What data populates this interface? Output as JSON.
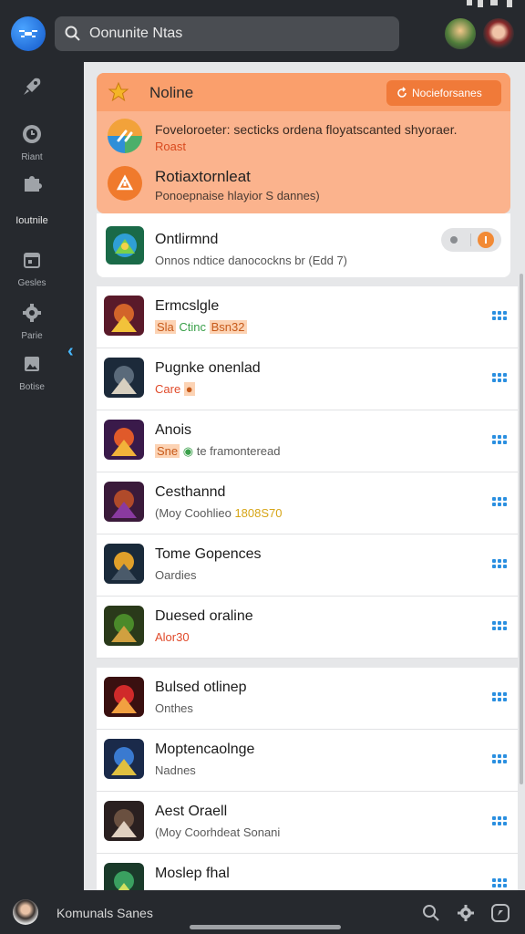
{
  "header": {
    "search_text": "Oonunite Ntas",
    "search_icon": "search-icon",
    "logo_icon": "drone-logo-icon"
  },
  "sidebar": {
    "items": [
      {
        "icon": "rocket-icon",
        "label": ""
      },
      {
        "icon": "clock-icon",
        "label": "Riant"
      },
      {
        "icon": "puzzle-icon",
        "label": ""
      },
      {
        "icon": "",
        "label": "Ioutnile"
      },
      {
        "icon": "calendar-icon",
        "label": "Gesles"
      },
      {
        "icon": "gear-icon",
        "label": "Parie"
      },
      {
        "icon": "image-icon",
        "label": "Botise"
      }
    ],
    "collapse_icon": "chevron-left-icon"
  },
  "notice": {
    "title": "Noline",
    "button_label": "Nocieforsanes",
    "item1_text": "Foveloroeter: secticks ordena floyatscanted shyoraer.",
    "item1_sub": "Roast",
    "item2_title": "Rotiaxtornleat",
    "item2_sub": "Ponoepnaise hlayior S dannes)"
  },
  "status_card": {
    "title": "Ontlirmnd",
    "sub": "Onnos ndtice danocockns br (Edd 7)"
  },
  "list_group1": [
    {
      "title": "Ermcslgle",
      "sub_parts": [
        {
          "t": "Sla",
          "c": "tag-o"
        },
        {
          "t": " Ctinc ",
          "c": "tag-g"
        },
        {
          "t": "Bsn32",
          "c": "tag-o"
        }
      ]
    },
    {
      "title": "Pugnke onenlad",
      "sub_parts": [
        {
          "t": "Care ",
          "c": "red"
        },
        {
          "t": "●",
          "c": "tag-o"
        }
      ]
    },
    {
      "title": "Anois",
      "sub_parts": [
        {
          "t": "Sne",
          "c": "tag-o"
        },
        {
          "t": " ◉ ",
          "c": "tag-g"
        },
        {
          "t": "te framonteread",
          "c": ""
        }
      ]
    },
    {
      "title": "Cesthannd",
      "sub_parts": [
        {
          "t": "(Moy Coohlieo ",
          "c": ""
        },
        {
          "t": "1808S70",
          "c": "tag-y"
        }
      ]
    },
    {
      "title": "Tome Gopences",
      "sub_parts": [
        {
          "t": "Oardies",
          "c": ""
        }
      ]
    },
    {
      "title": "Duesed oraline",
      "sub_parts": [
        {
          "t": "Alor30",
          "c": "red"
        }
      ]
    }
  ],
  "list_group2": [
    {
      "title": "Bulsed otlinep",
      "sub_parts": [
        {
          "t": "Onthes",
          "c": ""
        }
      ]
    },
    {
      "title": "Moptencaolnge",
      "sub_parts": [
        {
          "t": "Nadnes",
          "c": ""
        }
      ]
    },
    {
      "title": "Aest Oraell",
      "sub_parts": [
        {
          "t": "(Moy Coorhdeat Sonani",
          "c": ""
        }
      ]
    },
    {
      "title": "Moslep fhal",
      "sub_parts": [
        {
          "t": "",
          "c": ""
        }
      ]
    }
  ],
  "bottom": {
    "name": "Komunals Sanes",
    "icons": [
      "search-icon",
      "gear-icon",
      "compass-icon"
    ]
  },
  "colors": {
    "accent": "#fa9f6c",
    "button": "#f07a39",
    "link": "#2a8fe0",
    "sidebar_bg": "#26292e"
  }
}
